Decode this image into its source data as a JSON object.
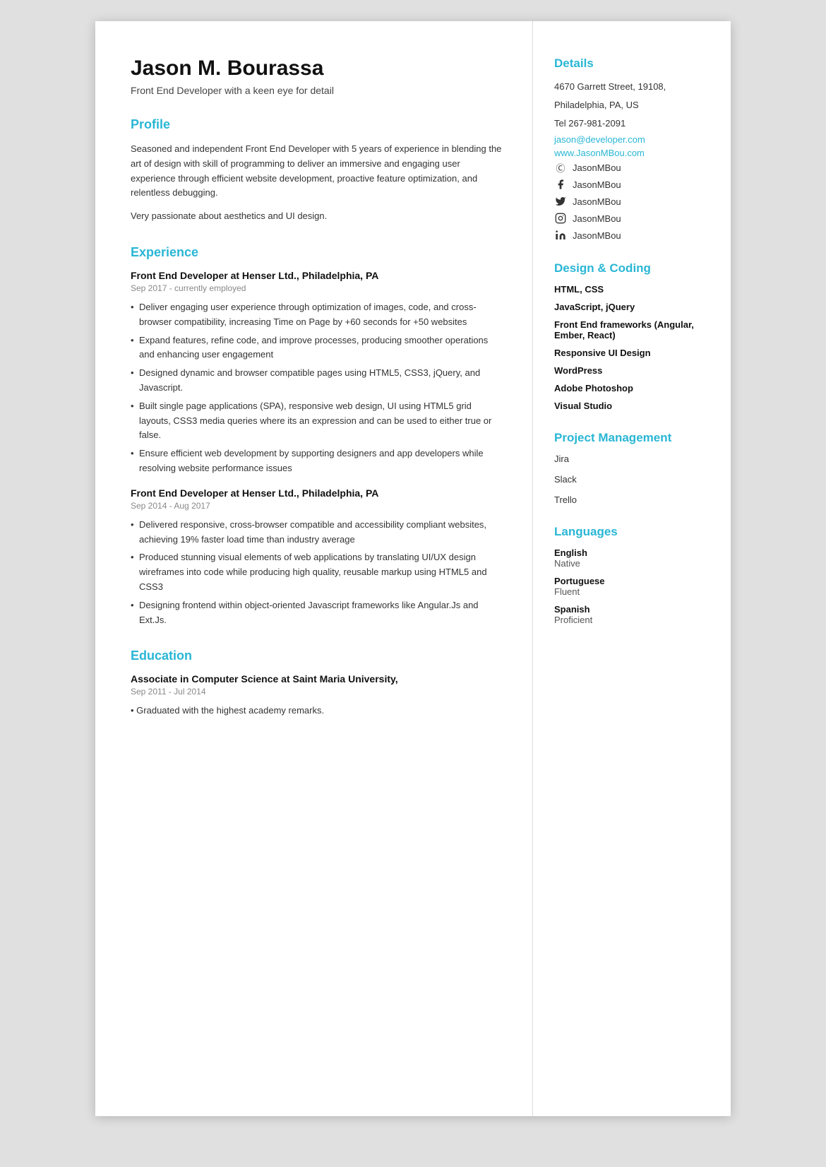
{
  "header": {
    "name": "Jason M. Bourassa",
    "tagline": "Front End Developer with a keen eye for detail"
  },
  "sections": {
    "profile": {
      "title": "Profile",
      "text1": "Seasoned and independent Front End Developer with 5 years of experience in blending the art of design with skill of programming to deliver an immersive and engaging user experience through efficient website development, proactive feature optimization, and relentless debugging.",
      "text2": "Very passionate about aesthetics and UI design."
    },
    "experience": {
      "title": "Experience",
      "jobs": [
        {
          "title": "Front End Developer at Henser Ltd., Philadelphia, PA",
          "date": "Sep 2017 - currently employed",
          "bullets": [
            "Deliver engaging user experience through optimization of images, code, and cross-browser compatibility, increasing Time on Page by +60 seconds for +50 websites",
            "Expand features, refine code, and improve processes, producing smoother operations and enhancing user engagement",
            "Designed dynamic and browser compatible pages using HTML5, CSS3, jQuery, and Javascript.",
            "Built single page applications (SPA), responsive web design, UI using HTML5 grid layouts, CSS3 media queries where its an expression and can be used to either true or false.",
            "Ensure efficient web development by supporting designers and app developers while resolving website performance issues"
          ]
        },
        {
          "title": "Front End Developer at Henser Ltd., Philadelphia, PA",
          "date": "Sep 2014 - Aug 2017",
          "bullets": [
            "Delivered responsive, cross-browser compatible and accessibility compliant websites, achieving 19% faster load time than industry average",
            "Produced stunning visual elements of web applications by translating UI/UX design wireframes into code while producing high quality, reusable markup using HTML5 and CSS3",
            "Designing frontend within object-oriented Javascript frameworks like Angular.Js and Ext.Js."
          ]
        }
      ]
    },
    "education": {
      "title": "Education",
      "entries": [
        {
          "title": "Associate in Computer Science at Saint Maria University,",
          "date": "Sep 2011 - Jul 2014",
          "text": "• Graduated with the highest academy remarks."
        }
      ]
    }
  },
  "sidebar": {
    "details": {
      "title": "Details",
      "address1": "4670 Garrett Street, 19108,",
      "address2": "Philadelphia, PA, US",
      "tel": "Tel 267-981-2091",
      "email": "jason@developer.com",
      "website": "www.JasonMBou.com"
    },
    "social": [
      {
        "icon": "skype",
        "handle": "JasonMBou"
      },
      {
        "icon": "facebook",
        "handle": "JasonMBou"
      },
      {
        "icon": "twitter",
        "handle": "JasonMBou"
      },
      {
        "icon": "instagram",
        "handle": "JasonMBou"
      },
      {
        "icon": "linkedin",
        "handle": "JasonMBou"
      }
    ],
    "design_coding": {
      "title": "Design & Coding",
      "skills": [
        "HTML, CSS",
        "JavaScript, jQuery",
        "Front End frameworks (Angular, Ember, React)",
        "Responsive UI Design",
        "WordPress",
        "Adobe Photoshop",
        "Visual Studio"
      ]
    },
    "project_management": {
      "title": "Project Management",
      "tools": [
        "Jira",
        "Slack",
        "Trello"
      ]
    },
    "languages": {
      "title": "Languages",
      "entries": [
        {
          "name": "English",
          "level": "Native"
        },
        {
          "name": "Portuguese",
          "level": "Fluent"
        },
        {
          "name": "Spanish",
          "level": "Proficient"
        }
      ]
    }
  }
}
